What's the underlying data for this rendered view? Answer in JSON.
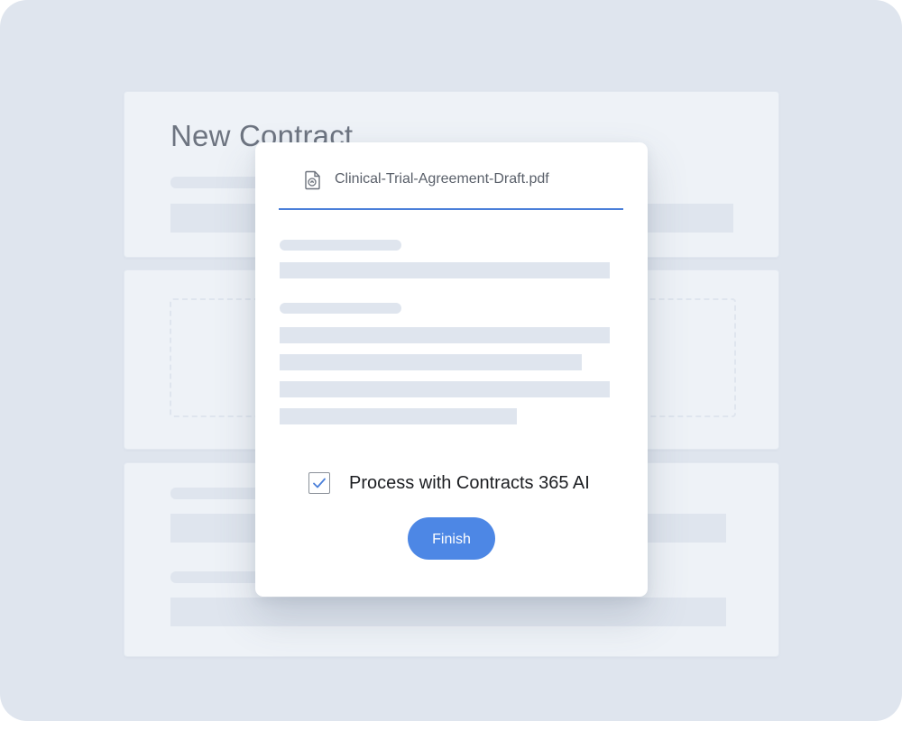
{
  "background": {
    "title": "New Contract"
  },
  "dialog": {
    "file_name": "Clinical-Trial-Agreement-Draft.pdf",
    "file_icon": "pdf-file-icon",
    "checkbox": {
      "label": "Process with Contracts 365 AI",
      "checked": true
    },
    "finish_label": "Finish"
  },
  "colors": {
    "accent": "#4d87e5",
    "underline": "#4a7fd9",
    "background": "#dfe5ee",
    "panel": "#eef2f7",
    "skeleton": "#dfe5ee"
  }
}
